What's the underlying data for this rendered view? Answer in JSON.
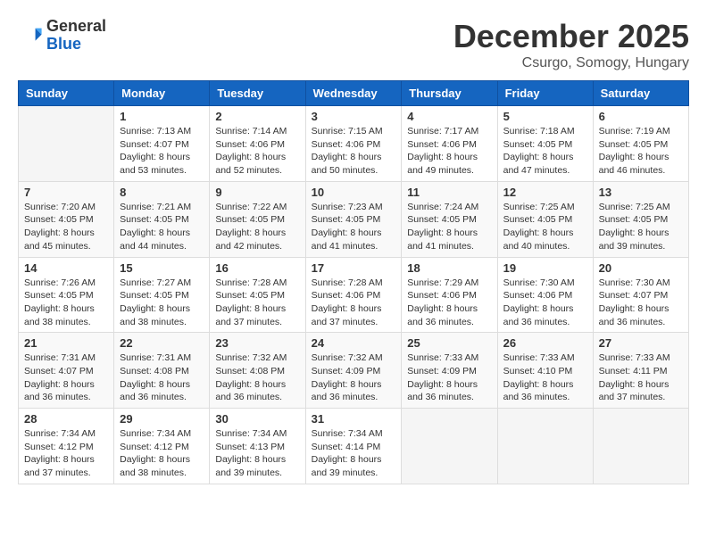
{
  "header": {
    "logo_general": "General",
    "logo_blue": "Blue",
    "month_title": "December 2025",
    "location": "Csurgo, Somogy, Hungary"
  },
  "calendar": {
    "days_of_week": [
      "Sunday",
      "Monday",
      "Tuesday",
      "Wednesday",
      "Thursday",
      "Friday",
      "Saturday"
    ],
    "weeks": [
      [
        {
          "day": "",
          "info": ""
        },
        {
          "day": "1",
          "info": "Sunrise: 7:13 AM\nSunset: 4:07 PM\nDaylight: 8 hours\nand 53 minutes."
        },
        {
          "day": "2",
          "info": "Sunrise: 7:14 AM\nSunset: 4:06 PM\nDaylight: 8 hours\nand 52 minutes."
        },
        {
          "day": "3",
          "info": "Sunrise: 7:15 AM\nSunset: 4:06 PM\nDaylight: 8 hours\nand 50 minutes."
        },
        {
          "day": "4",
          "info": "Sunrise: 7:17 AM\nSunset: 4:06 PM\nDaylight: 8 hours\nand 49 minutes."
        },
        {
          "day": "5",
          "info": "Sunrise: 7:18 AM\nSunset: 4:05 PM\nDaylight: 8 hours\nand 47 minutes."
        },
        {
          "day": "6",
          "info": "Sunrise: 7:19 AM\nSunset: 4:05 PM\nDaylight: 8 hours\nand 46 minutes."
        }
      ],
      [
        {
          "day": "7",
          "info": "Sunrise: 7:20 AM\nSunset: 4:05 PM\nDaylight: 8 hours\nand 45 minutes."
        },
        {
          "day": "8",
          "info": "Sunrise: 7:21 AM\nSunset: 4:05 PM\nDaylight: 8 hours\nand 44 minutes."
        },
        {
          "day": "9",
          "info": "Sunrise: 7:22 AM\nSunset: 4:05 PM\nDaylight: 8 hours\nand 42 minutes."
        },
        {
          "day": "10",
          "info": "Sunrise: 7:23 AM\nSunset: 4:05 PM\nDaylight: 8 hours\nand 41 minutes."
        },
        {
          "day": "11",
          "info": "Sunrise: 7:24 AM\nSunset: 4:05 PM\nDaylight: 8 hours\nand 41 minutes."
        },
        {
          "day": "12",
          "info": "Sunrise: 7:25 AM\nSunset: 4:05 PM\nDaylight: 8 hours\nand 40 minutes."
        },
        {
          "day": "13",
          "info": "Sunrise: 7:25 AM\nSunset: 4:05 PM\nDaylight: 8 hours\nand 39 minutes."
        }
      ],
      [
        {
          "day": "14",
          "info": "Sunrise: 7:26 AM\nSunset: 4:05 PM\nDaylight: 8 hours\nand 38 minutes."
        },
        {
          "day": "15",
          "info": "Sunrise: 7:27 AM\nSunset: 4:05 PM\nDaylight: 8 hours\nand 38 minutes."
        },
        {
          "day": "16",
          "info": "Sunrise: 7:28 AM\nSunset: 4:05 PM\nDaylight: 8 hours\nand 37 minutes."
        },
        {
          "day": "17",
          "info": "Sunrise: 7:28 AM\nSunset: 4:06 PM\nDaylight: 8 hours\nand 37 minutes."
        },
        {
          "day": "18",
          "info": "Sunrise: 7:29 AM\nSunset: 4:06 PM\nDaylight: 8 hours\nand 36 minutes."
        },
        {
          "day": "19",
          "info": "Sunrise: 7:30 AM\nSunset: 4:06 PM\nDaylight: 8 hours\nand 36 minutes."
        },
        {
          "day": "20",
          "info": "Sunrise: 7:30 AM\nSunset: 4:07 PM\nDaylight: 8 hours\nand 36 minutes."
        }
      ],
      [
        {
          "day": "21",
          "info": "Sunrise: 7:31 AM\nSunset: 4:07 PM\nDaylight: 8 hours\nand 36 minutes."
        },
        {
          "day": "22",
          "info": "Sunrise: 7:31 AM\nSunset: 4:08 PM\nDaylight: 8 hours\nand 36 minutes."
        },
        {
          "day": "23",
          "info": "Sunrise: 7:32 AM\nSunset: 4:08 PM\nDaylight: 8 hours\nand 36 minutes."
        },
        {
          "day": "24",
          "info": "Sunrise: 7:32 AM\nSunset: 4:09 PM\nDaylight: 8 hours\nand 36 minutes."
        },
        {
          "day": "25",
          "info": "Sunrise: 7:33 AM\nSunset: 4:09 PM\nDaylight: 8 hours\nand 36 minutes."
        },
        {
          "day": "26",
          "info": "Sunrise: 7:33 AM\nSunset: 4:10 PM\nDaylight: 8 hours\nand 36 minutes."
        },
        {
          "day": "27",
          "info": "Sunrise: 7:33 AM\nSunset: 4:11 PM\nDaylight: 8 hours\nand 37 minutes."
        }
      ],
      [
        {
          "day": "28",
          "info": "Sunrise: 7:34 AM\nSunset: 4:12 PM\nDaylight: 8 hours\nand 37 minutes."
        },
        {
          "day": "29",
          "info": "Sunrise: 7:34 AM\nSunset: 4:12 PM\nDaylight: 8 hours\nand 38 minutes."
        },
        {
          "day": "30",
          "info": "Sunrise: 7:34 AM\nSunset: 4:13 PM\nDaylight: 8 hours\nand 39 minutes."
        },
        {
          "day": "31",
          "info": "Sunrise: 7:34 AM\nSunset: 4:14 PM\nDaylight: 8 hours\nand 39 minutes."
        },
        {
          "day": "",
          "info": ""
        },
        {
          "day": "",
          "info": ""
        },
        {
          "day": "",
          "info": ""
        }
      ]
    ]
  }
}
